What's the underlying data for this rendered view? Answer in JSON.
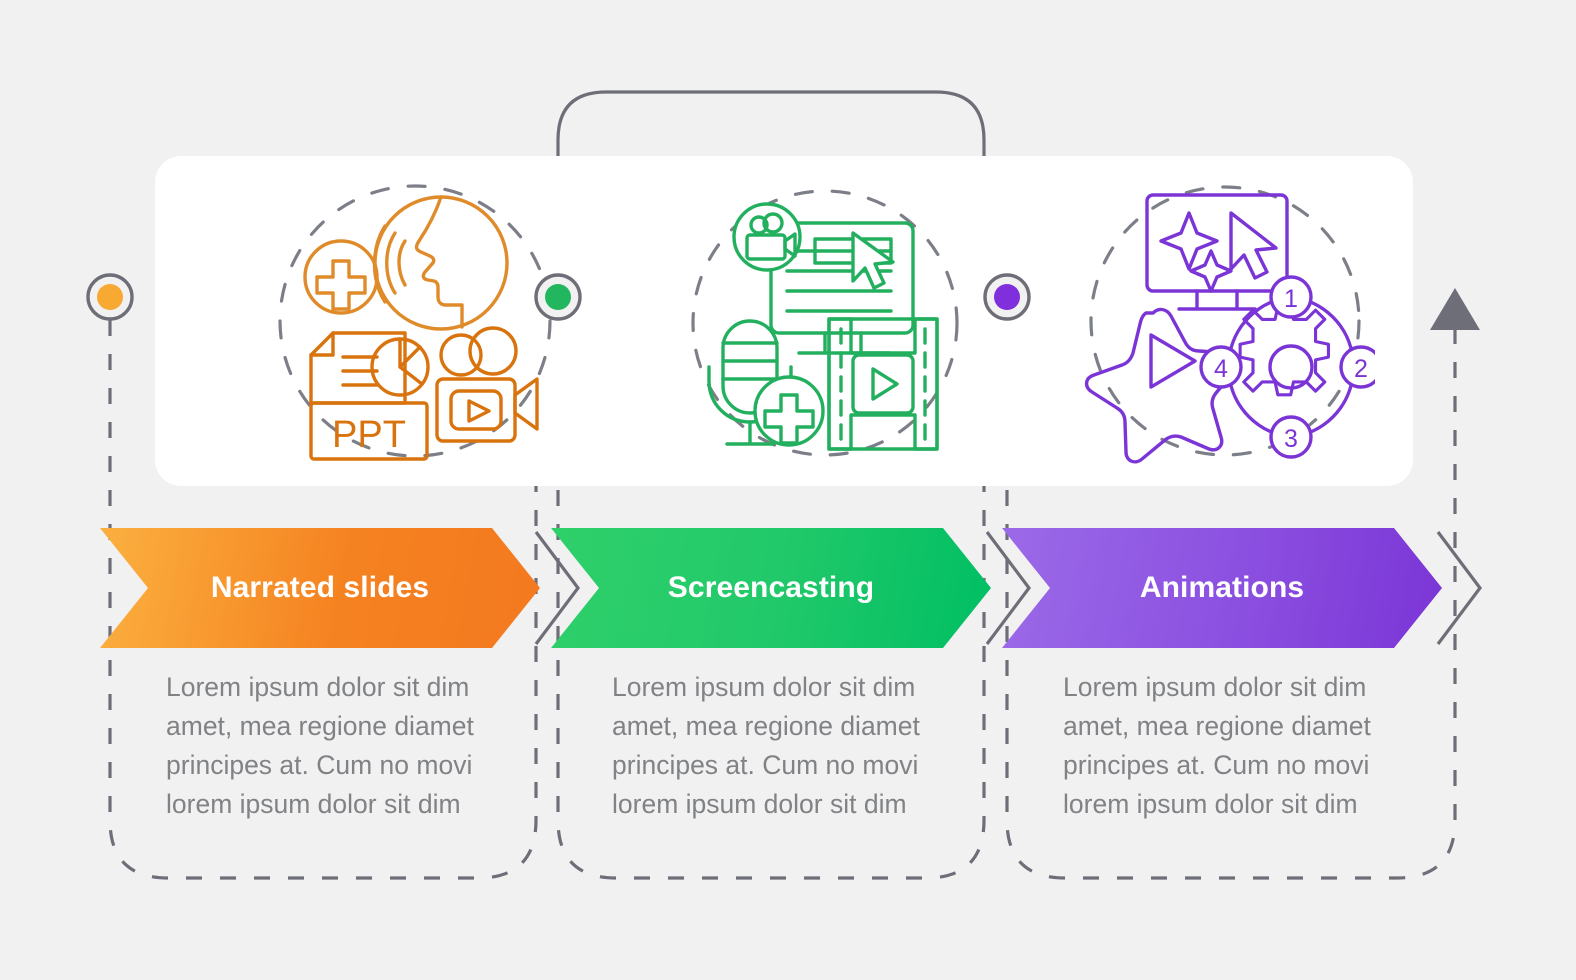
{
  "page": {
    "background_color": "#f1f1f1",
    "card_color": "#ffffff",
    "connector_color": "#6d6e78",
    "text_color": "#808285"
  },
  "steps": [
    {
      "id": "narrated-slides",
      "label": "Narrated slides",
      "color": "#f7941e",
      "gradient_from": "#fbb040",
      "gradient_to": "#f47920",
      "dot_color": "#f7a932",
      "icon_name": "narrated-slides-icon",
      "description": "Lorem ipsum dolor sit dim amet, mea regione diamet principes at. Cum no movi lorem ipsum dolor sit dim"
    },
    {
      "id": "screencasting",
      "label": "Screencasting",
      "color": "#22c06a",
      "gradient_from": "#2fd06a",
      "gradient_to": "#00bf63",
      "dot_color": "#22b65f",
      "icon_name": "screencasting-icon",
      "description": "Lorem ipsum dolor sit dim amet, mea regione diamet principes at. Cum no movi lorem ipsum dolor sit dim"
    },
    {
      "id": "animations",
      "label": "Animations",
      "color": "#7b35d6",
      "gradient_from": "#9b6ae8",
      "gradient_to": "#7b35d6",
      "dot_color": "#7f2fdb",
      "icon_name": "animations-icon",
      "description": "Lorem ipsum dolor sit dim amet, mea regione diamet principes at. Cum no movi lorem ipsum dolor sit dim"
    }
  ],
  "icon_details": {
    "narrated_slides": {
      "parts": [
        "speaking-face-circle-icon",
        "plus-badge-icon",
        "ppt-document-icon",
        "pie-chart-icon",
        "video-camera-icon"
      ],
      "document_label": "PPT"
    },
    "screencasting": {
      "parts": [
        "monitor-icon",
        "cursor-icon",
        "video-camera-badge-icon",
        "microphone-icon",
        "plus-badge-icon",
        "film-strip-icon",
        "play-icon"
      ]
    },
    "animations": {
      "parts": [
        "monitor-icon",
        "sparkle-icon",
        "cursor-icon",
        "star-icon",
        "play-icon",
        "gear-icon",
        "cycle-arrows-icon"
      ],
      "cycle_numbers": [
        "1",
        "2",
        "3",
        "4"
      ]
    }
  },
  "flow": {
    "arrow_name": "flow-arrow-up",
    "arrow_color": "#6d6e78"
  }
}
